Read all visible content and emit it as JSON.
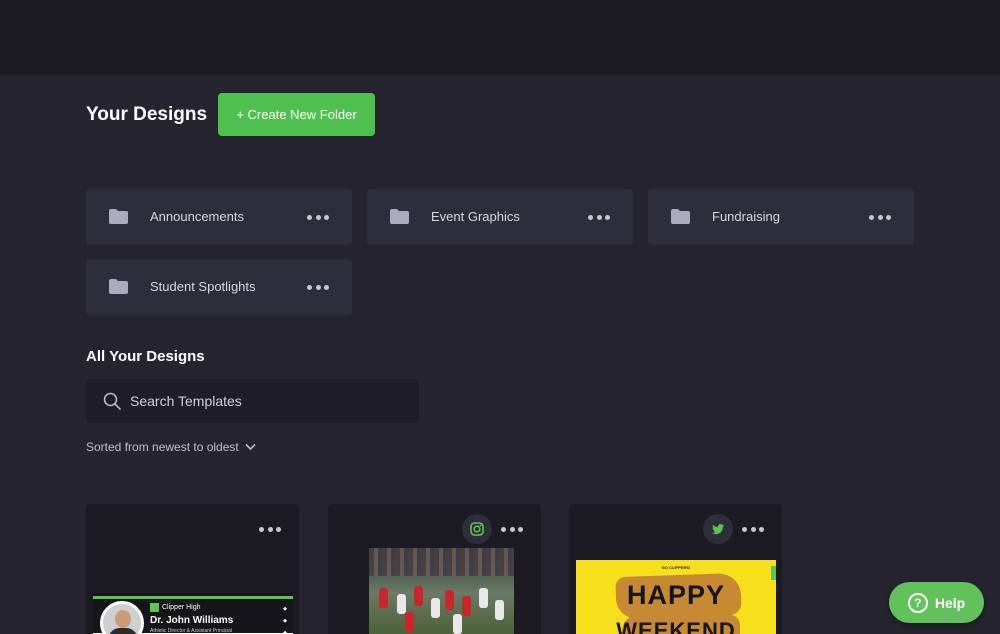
{
  "header": {
    "title": "Your Designs",
    "create_folder_label": "+ Create New Folder"
  },
  "folders": [
    {
      "name": "Announcements"
    },
    {
      "name": "Event Graphics"
    },
    {
      "name": "Fundraising"
    },
    {
      "name": "Student Spotlights"
    }
  ],
  "all_designs": {
    "title": "All Your Designs",
    "search_placeholder": "Search Templates",
    "sort_label": "Sorted from newest to oldest"
  },
  "designs": [
    {
      "social": "",
      "preview": {
        "school": "Clipper High",
        "name": "Dr. John Williams",
        "role": "Athletic Director & Assistant Principal"
      }
    },
    {
      "social": "instagram-icon"
    },
    {
      "social": "twitter-icon",
      "preview": {
        "small_text": "GO CLIPPERS!",
        "line1": "HAPPY",
        "line2": "WEEKEND"
      }
    }
  ],
  "help": {
    "label": "Help"
  },
  "colors": {
    "accent": "#4fc04f",
    "background": "#25242f",
    "topbar": "#1c1b24",
    "folder": "#2e2d3b"
  }
}
